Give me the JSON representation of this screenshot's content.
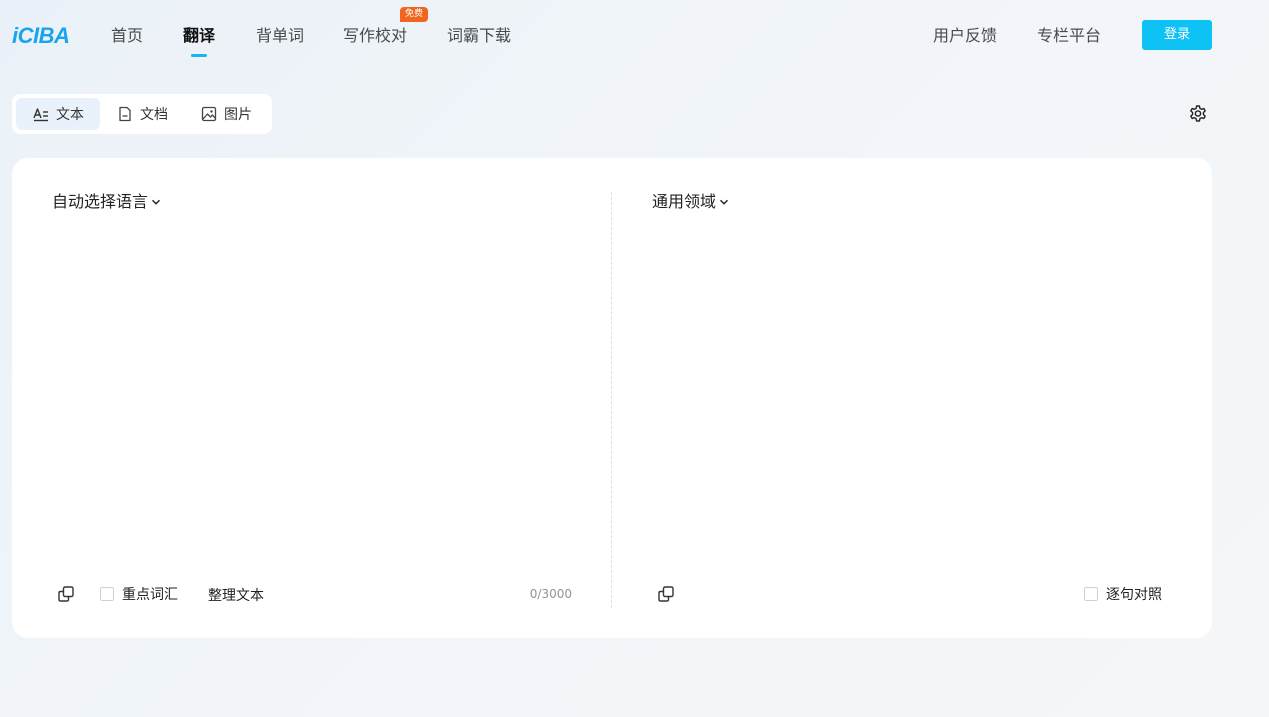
{
  "logo": "iCIBA",
  "nav": {
    "items": [
      "首页",
      "翻译",
      "背单词",
      "写作校对",
      "词霸下载"
    ],
    "active": "翻译",
    "badge": "免费",
    "right_items": [
      "用户反馈",
      "专栏平台"
    ],
    "login": "登录"
  },
  "mode_tabs": {
    "items": [
      "文本",
      "文档",
      "图片"
    ],
    "selected": "文本"
  },
  "icons": {
    "settings": "gear-icon",
    "text": "text-mode-icon",
    "doc": "document-icon",
    "image": "image-icon",
    "copy": "copy-icon",
    "chevron": "chevron-down-icon"
  },
  "source": {
    "language": "自动选择语言",
    "value": "",
    "key_vocab": "重点词汇",
    "tidy": "整理文本",
    "counter": "0/3000"
  },
  "target": {
    "domain": "通用领域",
    "bilingual": "逐句对照"
  },
  "colors": {
    "accent": "#0ec2f6",
    "logo": "#1aa3ee",
    "badge": "#f0651f"
  }
}
